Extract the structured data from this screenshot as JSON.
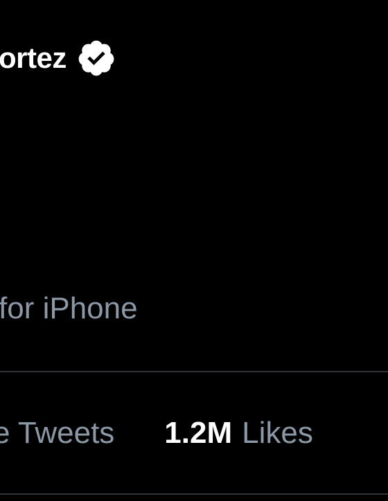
{
  "tweet": {
    "author": {
      "display_name_visible": "ortez",
      "verified_icon": "verified-badge-icon"
    },
    "source_text": "for iPhone",
    "stats": {
      "quote_tweets_label": "e Tweets",
      "likes_count": "1.2M",
      "likes_label": "Likes"
    }
  },
  "colors": {
    "background": "#000000",
    "primary_text": "#FFFFFF",
    "secondary_text": "#8B98A5",
    "divider": "#2F3336"
  }
}
